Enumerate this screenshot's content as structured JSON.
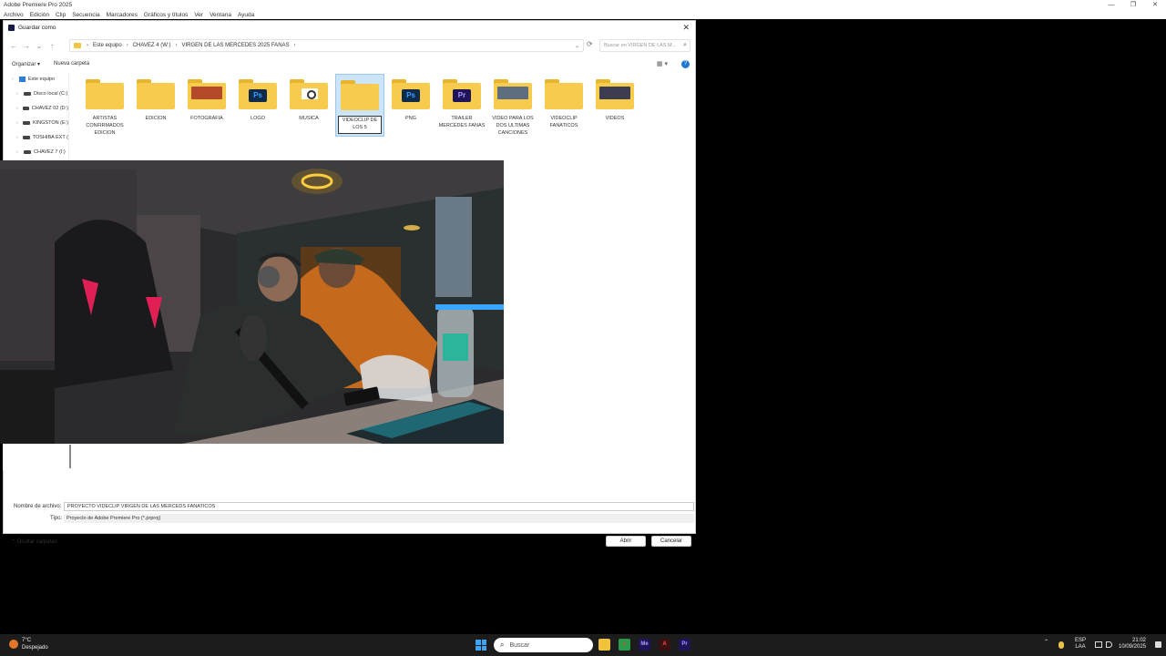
{
  "app": {
    "title": "Adobe Premiere Pro 2025",
    "menu": [
      "Archivo",
      "Edición",
      "Clip",
      "Secuencia",
      "Marcadores",
      "Gráficos y títulos",
      "Ver",
      "Ventana",
      "Ayuda"
    ],
    "window_controls": [
      "—",
      "❐",
      "✕"
    ]
  },
  "dialog": {
    "title": "Guardar como",
    "close_glyph": "✕",
    "nav": {
      "back": "←",
      "forward": "→",
      "recent": "⌄",
      "up": "↑",
      "refresh": "⟳"
    },
    "breadcrumb": [
      "Este equipo",
      "CHAVEZ 4 (W:)",
      "VIRGEN DE LAS MERCEDES 2025 FANAS"
    ],
    "breadcrumb_sep": "›",
    "address_chevron": "⌄",
    "search_placeholder": "Buscar en VIRGEN DE LAS M...",
    "search_icon": "⌕",
    "organize": "Organizar ▾",
    "new_folder": "Nueva carpeta",
    "view_glyph": "▦ ▾",
    "help_glyph": "?",
    "sidebar": [
      {
        "label": "Este equipo",
        "icon": "computer-icon"
      },
      {
        "label": "Disco local (C:)",
        "icon": "drive-icon"
      },
      {
        "label": "CHAVEZ 02 (D:)",
        "icon": "drive-icon"
      },
      {
        "label": "KINGSTON (E:)",
        "icon": "drive-icon"
      },
      {
        "label": "TOSHIBA EXT (",
        "icon": "drive-icon"
      },
      {
        "label": "CHAVEZ 7 (I:)",
        "icon": "drive-icon"
      }
    ],
    "expand_glyph": "›",
    "folders": [
      {
        "label": "ARTISTAS CONFIRMADOS EDICION",
        "kind": "plain"
      },
      {
        "label": "EDICION",
        "kind": "plain"
      },
      {
        "label": "FOTOGRAFIA",
        "kind": "photo",
        "color": "#b54a2a"
      },
      {
        "label": "LOGO",
        "kind": "ps"
      },
      {
        "label": "MUSICA",
        "kind": "doc"
      },
      {
        "label": "VIDEOCLIP DE LOS 5",
        "kind": "plain",
        "selected": true
      },
      {
        "label": "PNG",
        "kind": "ps"
      },
      {
        "label": "TRAILER MERCEDES FANAS",
        "kind": "pr"
      },
      {
        "label": "VIDEO PARA LOS DOS ULTIMAS CANCIONES",
        "kind": "photo",
        "color": "#5e6e7e"
      },
      {
        "label": "VIDEOCLIP FANATICOS",
        "kind": "plain"
      },
      {
        "label": "VIDEOS",
        "kind": "photo",
        "color": "#3d3d52"
      }
    ],
    "badge_ps": "Ps",
    "badge_pr": "Pr",
    "filename_label": "Nombre de archivo:",
    "filename_value": "PROYECTO VIDECLIP VIRGEN DE LAS MERCEDS FANATICOS",
    "type_label": "Tipo:",
    "type_value": "Proyecto de Adobe Premiere Pro (*.prproj)",
    "hide_folders": "⌃ Ocultar carpetas",
    "open_button": "Abrir",
    "cancel_button": "Cancelar"
  },
  "taskbar": {
    "weather_temp": "7°C",
    "weather_desc": "Despejado",
    "search_placeholder": "Buscar",
    "search_icon": "⌕",
    "apps": [
      {
        "name": "file-explorer-icon",
        "glyph": "",
        "bg": "#f2c23a",
        "fg": "#000"
      },
      {
        "name": "chrome-icon",
        "glyph": "●",
        "bg": "#2b9a4a",
        "fg": "#e8453c"
      },
      {
        "name": "media-encoder-icon",
        "glyph": "Me",
        "bg": "#1f1458",
        "fg": "#a99cff"
      },
      {
        "name": "acrobat-icon",
        "glyph": "A",
        "bg": "#3a1010",
        "fg": "#ff4b4b"
      },
      {
        "name": "premiere-icon",
        "glyph": "Pr",
        "bg": "#1f1458",
        "fg": "#a99cff"
      }
    ],
    "tray_chevron": "⌃",
    "lang_top": "ESP",
    "lang_bottom": "LAA",
    "time": "21:02",
    "date": "10/09/2025"
  }
}
